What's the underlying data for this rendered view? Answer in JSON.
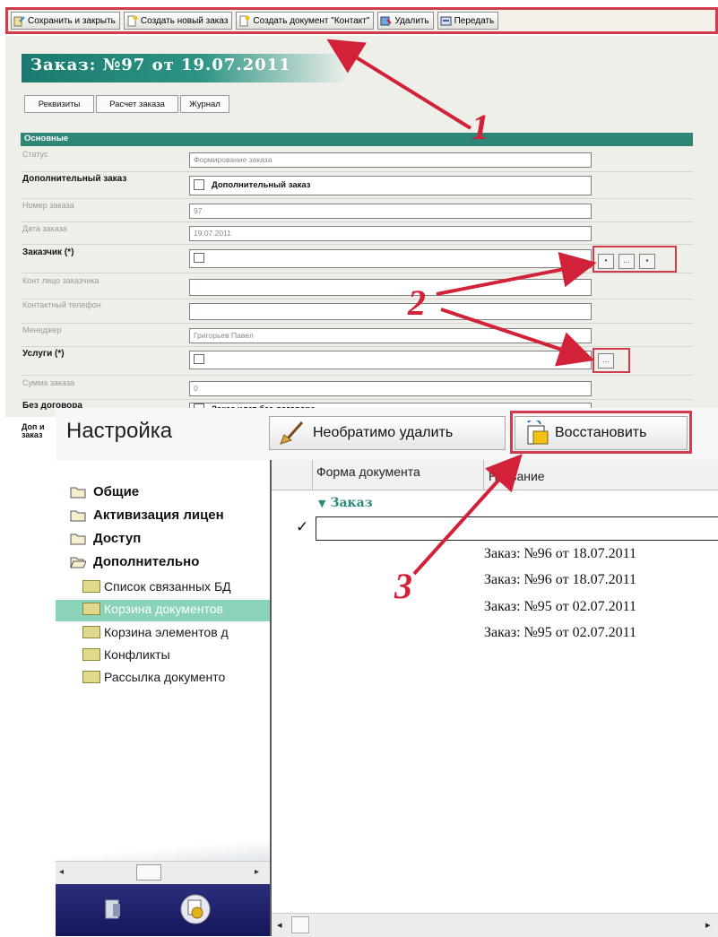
{
  "toolbar": {
    "buttons": [
      {
        "label": "Сохранить и закрыть",
        "icon": "save-close-icon"
      },
      {
        "label": "Создать новый заказ",
        "icon": "new-document-icon"
      },
      {
        "label": "Создать документ \"Контакт\"",
        "icon": "new-document-icon"
      },
      {
        "label": "Удалить",
        "icon": "delete-icon"
      },
      {
        "label": "Передать",
        "icon": "transfer-icon"
      }
    ]
  },
  "order": {
    "title": "Заказ: №97 от 19.07.2011",
    "tabs": [
      "Реквизиты",
      "Расчет заказа",
      "Журнал"
    ],
    "section": "Основные",
    "fields": {
      "status": {
        "label": "Статус",
        "value": "Формирование заказа"
      },
      "additional": {
        "label": "Дополнительный заказ",
        "checkbox_label": "Дополнительный заказ"
      },
      "number": {
        "label": "Номер заказа",
        "value": "97"
      },
      "date": {
        "label": "Дата заказа",
        "value": "19.07.2011"
      },
      "customer": {
        "label": "Заказчик (*)"
      },
      "contact_person": {
        "label": "Конт лицо заказчика",
        "value": ""
      },
      "contact_phone": {
        "label": "Контактный телефон",
        "value": ""
      },
      "manager": {
        "label": "Менеджер",
        "value": "Григорьев Павел"
      },
      "services": {
        "label": "Услуги (*)"
      },
      "sum": {
        "label": "Сумма заказа",
        "value": "0"
      },
      "no_contract": {
        "label": "Без договора",
        "checkbox_label": "Заказ идет без договора"
      },
      "extra": {
        "label": "Доп и заказ"
      }
    }
  },
  "settings": {
    "title": "Настройка",
    "buttons": {
      "delete_permanently": "Необратимо удалить",
      "restore": "Восстановить"
    },
    "tree": {
      "folders": [
        {
          "label": "Общие",
          "open": false
        },
        {
          "label": "Активизация лицен",
          "open": false
        },
        {
          "label": "Доступ",
          "open": false
        },
        {
          "label": "Дополнительно",
          "open": true
        }
      ],
      "children": [
        {
          "label": "Список связанных БД",
          "selected": false
        },
        {
          "label": "Корзина документов",
          "selected": true
        },
        {
          "label": "Корзина элементов д",
          "selected": false
        },
        {
          "label": "Конфликты",
          "selected": false
        },
        {
          "label": "Рассылка документо",
          "selected": false
        }
      ]
    },
    "grid": {
      "columns": [
        "Форма документа",
        "Название"
      ],
      "group": "Заказ",
      "rows": [
        {
          "name": "",
          "checked": true
        },
        {
          "name": "Заказ: №96 от 18.07.2011",
          "checked": false
        },
        {
          "name": "Заказ: №96 от 18.07.2011",
          "checked": false
        },
        {
          "name": "Заказ: №95 от 02.07.2011",
          "checked": false
        },
        {
          "name": "Заказ: №95 от 02.07.2011",
          "checked": false
        }
      ]
    }
  },
  "callouts": {
    "one": "1",
    "two": "2",
    "three": "3"
  },
  "colors": {
    "annotation_red": "#d2223a",
    "teal": "#2e8676",
    "selection": "#8ad3b9"
  }
}
